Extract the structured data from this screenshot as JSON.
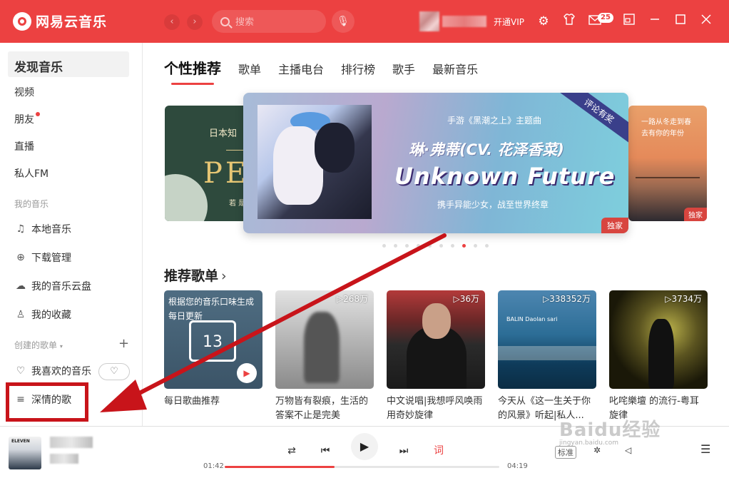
{
  "app": {
    "name": "网易云音乐"
  },
  "header": {
    "back": "‹",
    "forward": "›",
    "search_placeholder": "搜索",
    "vip_label": "开通VIP",
    "mail_badge": "25",
    "icons": [
      "settings-icon",
      "skin-icon",
      "mail-icon",
      "mini-mode-icon",
      "minimize-icon",
      "maximize-icon",
      "close-icon"
    ]
  },
  "sidebar": {
    "discover": "发现音乐",
    "video": "视频",
    "friends": "朋友",
    "live": "直播",
    "fm": "私人FM",
    "my_music_section": "我的音乐",
    "local": "本地音乐",
    "download": "下载管理",
    "cloud": "我的音乐云盘",
    "collect": "我的收藏",
    "created_section": "创建的歌单",
    "liked": "我喜欢的音乐",
    "playlist1": "深情的歌"
  },
  "tabs": [
    "个性推荐",
    "歌单",
    "主播电台",
    "排行榜",
    "歌手",
    "最新音乐"
  ],
  "banner": {
    "left_line1": "日本知",
    "left_big": "PE",
    "left_small": "若 是",
    "main_line1": "手游《黑潮之上》主题曲",
    "main_line2": "琳·弗蒂(CV. 花泽香菜)",
    "main_line3": "Unknown Future",
    "main_line4": "携手异能少女，战至世界终章",
    "ribbon": "评论有奖",
    "exclusive": "独家",
    "right_line1": "一路从冬走到春",
    "right_line2": "去有你的年份",
    "dots_total": 10,
    "dots_active": 8
  },
  "recommend": {
    "title": "推荐歌单",
    "chevron": "›",
    "daily_overlay1": "根据您的音乐口味生成",
    "daily_overlay2": "每日更新",
    "daily_date": "13",
    "cards": [
      {
        "name": "每日歌曲推荐",
        "plays": ""
      },
      {
        "name": "万物皆有裂痕，生活的答案不止是完美",
        "plays": "▷268万"
      },
      {
        "name": "中文说唱|我想呼风唤雨用奇妙旋律",
        "plays": "▷36万"
      },
      {
        "name": "今天从《这一生关于你的风景》听起|私人...",
        "plays": "▷338352万"
      },
      {
        "name": "叱咤樂壇 的流行-粤耳旋律",
        "plays": "▷3734万"
      }
    ],
    "card4_tag": "BALIN Daolan sari"
  },
  "player": {
    "album_text": "ELEVEN",
    "time_current": "01:42",
    "time_total": "04:19",
    "progress": 0.4,
    "quality": "标准",
    "lyric_btn": "词"
  },
  "watermark": {
    "text": "Baidu经验",
    "sub": "jingyan.baidu.com"
  },
  "colors": {
    "accent": "#ec4141",
    "highlight_box": "#c8141a"
  }
}
